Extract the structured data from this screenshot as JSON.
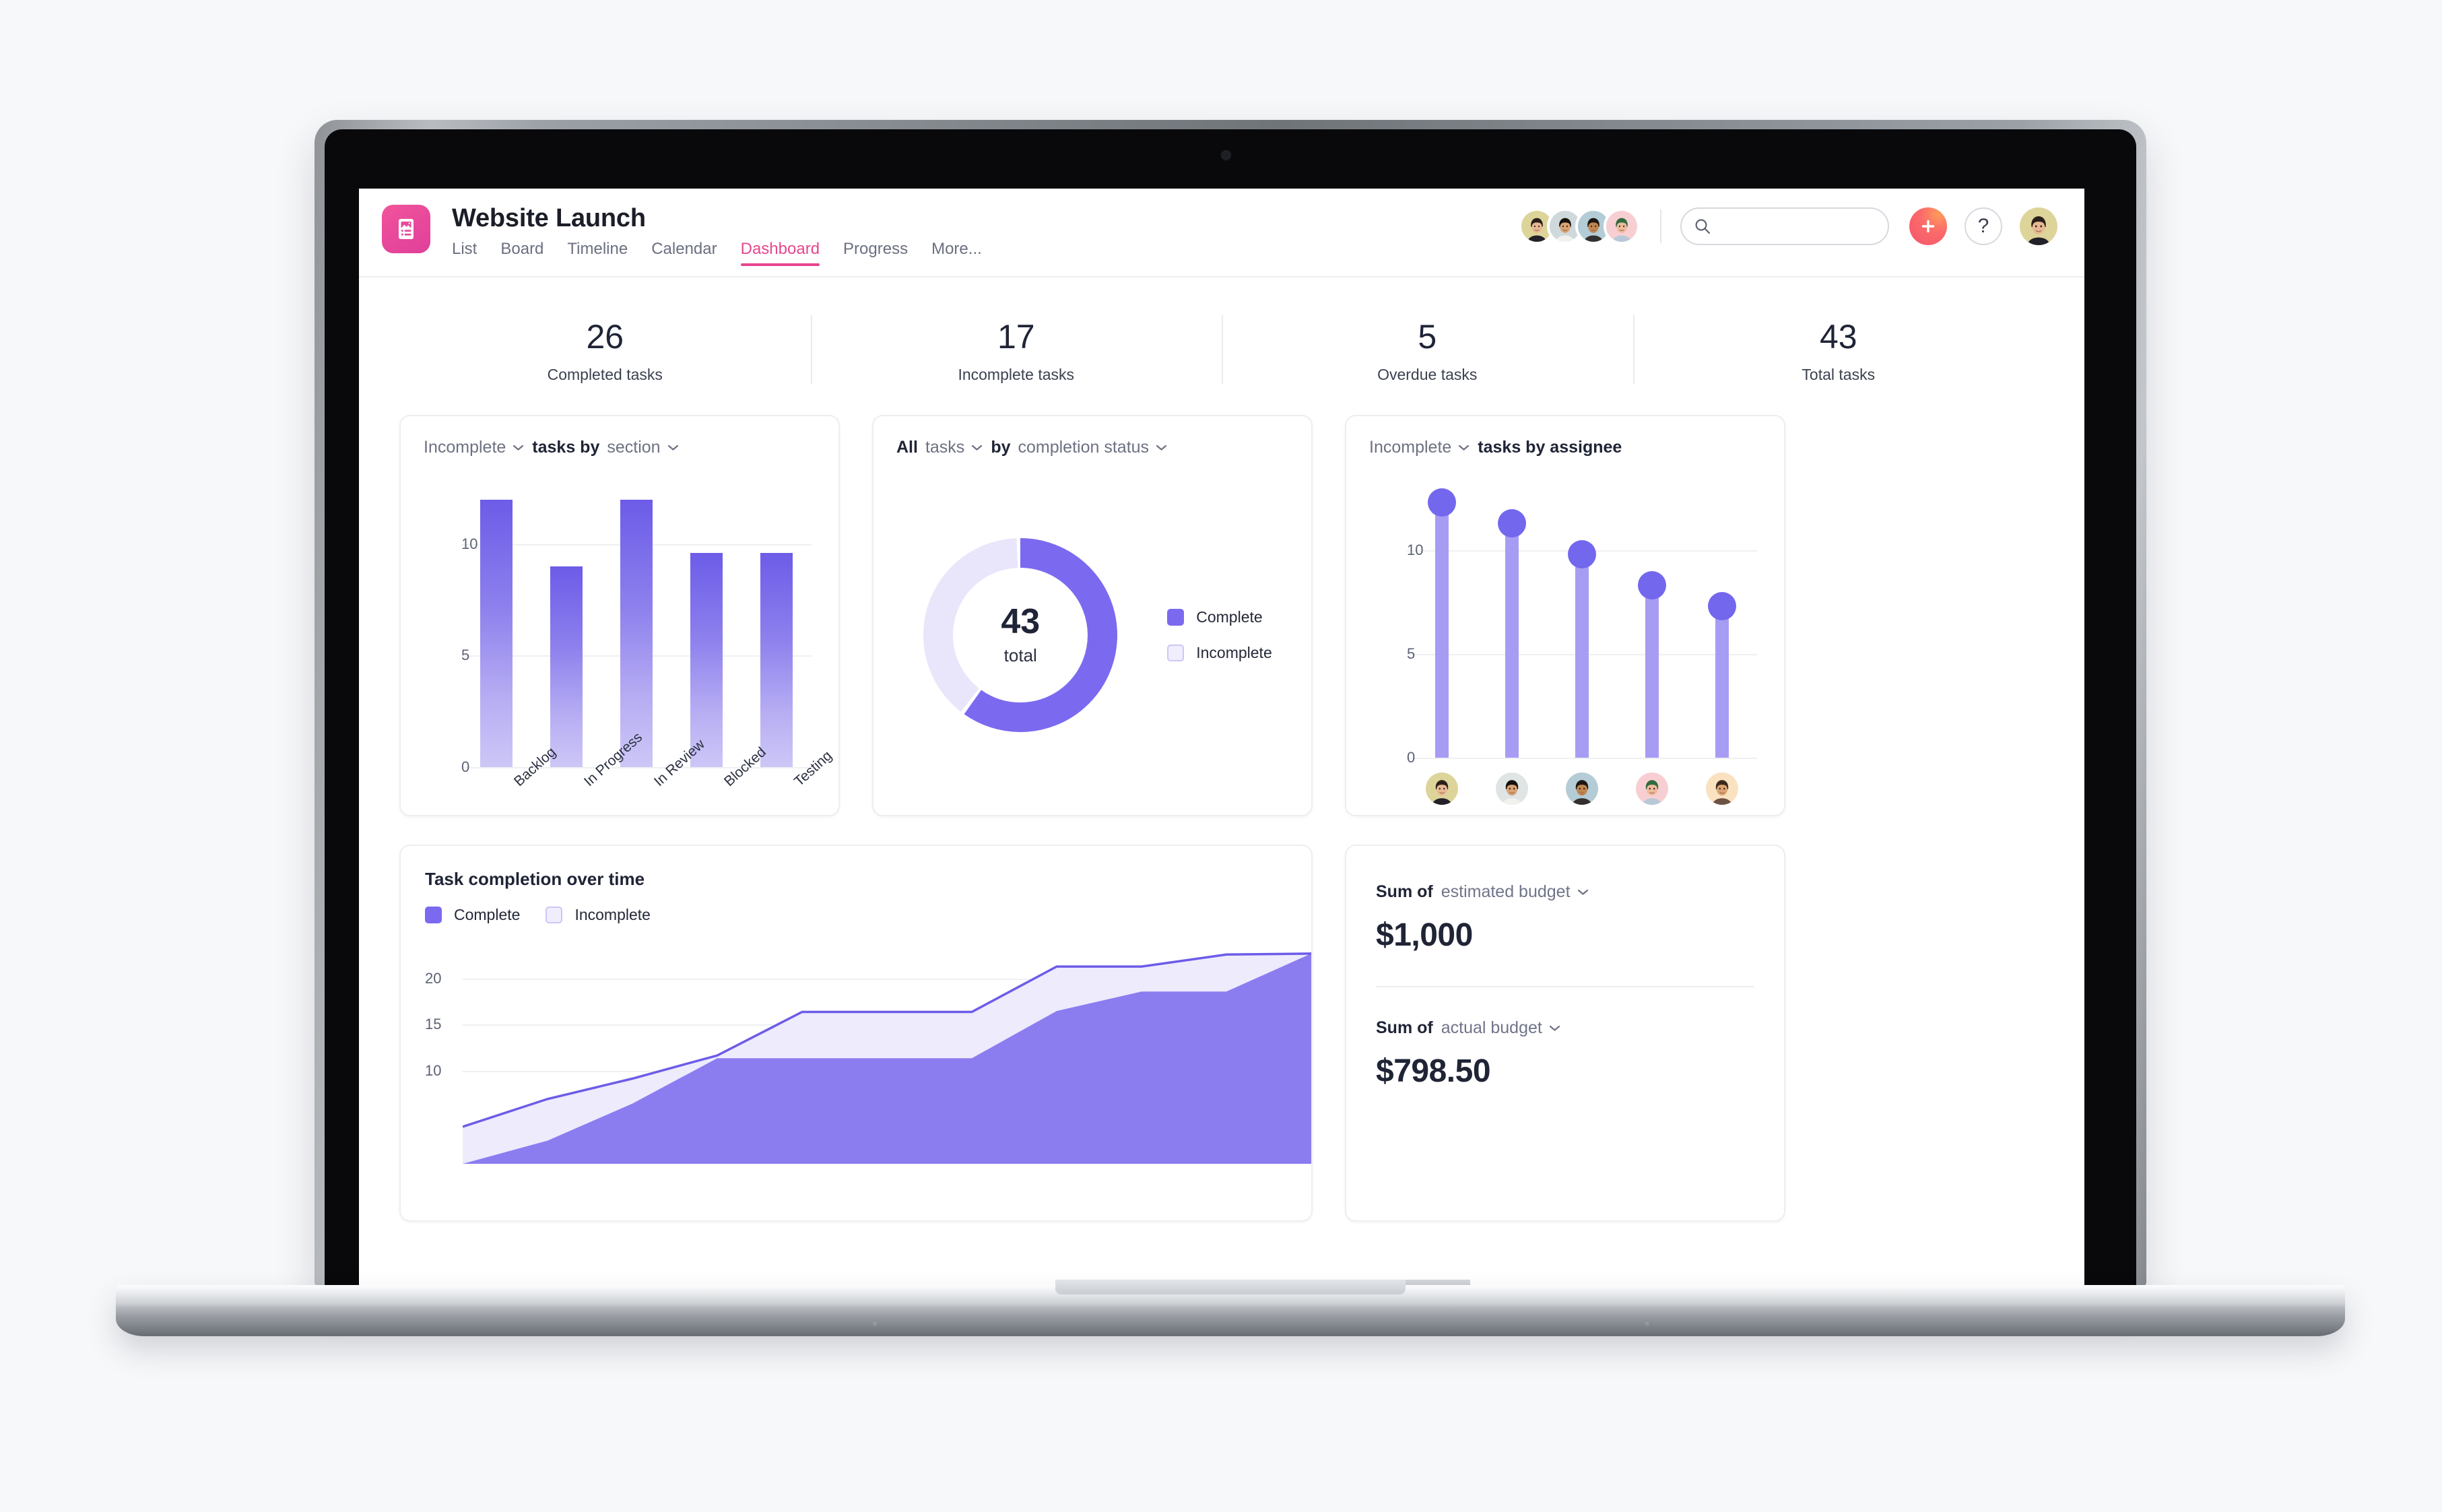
{
  "header": {
    "app_title": "Website Launch",
    "logo_icon": "project-page-icon",
    "tabs": [
      {
        "label": "List",
        "active": false
      },
      {
        "label": "Board",
        "active": false
      },
      {
        "label": "Timeline",
        "active": false
      },
      {
        "label": "Calendar",
        "active": false
      },
      {
        "label": "Dashboard",
        "active": true
      },
      {
        "label": "Progress",
        "active": false
      },
      {
        "label": "More...",
        "active": false
      }
    ],
    "member_avatars": [
      {
        "name": "member-1",
        "bg": "#ddd49a",
        "skin": "#e8b894",
        "hair": "#2a1f1a",
        "shirt": "#222028"
      },
      {
        "name": "member-2",
        "bg": "#cfd9dc",
        "skin": "#d8a273",
        "hair": "#15100e",
        "shirt": "#f2f1ee"
      },
      {
        "name": "member-3",
        "bg": "#b3ccd6",
        "skin": "#c08650",
        "hair": "#1c1713",
        "shirt": "#33302f"
      },
      {
        "name": "member-4",
        "bg": "#f7cfd3",
        "skin": "#eebb9c",
        "hair": "#2f6b3f",
        "shirt": "#b8c8d8"
      }
    ],
    "search": {
      "placeholder": "",
      "value": "",
      "icon": "search-icon"
    },
    "add_button": {
      "label": "+",
      "icon": "plus-icon",
      "color": "#f4566c"
    },
    "help_button": {
      "label": "?",
      "icon": "question-mark-icon"
    },
    "me_avatar": {
      "name": "current-user",
      "bg": "#ddd49a",
      "skin": "#e8b894",
      "hair": "#2a1f1a",
      "shirt": "#222028"
    }
  },
  "stats": [
    {
      "value": "26",
      "label": "Completed tasks"
    },
    {
      "value": "17",
      "label": "Incomplete tasks"
    },
    {
      "value": "5",
      "label": "Overdue tasks"
    },
    {
      "value": "43",
      "label": "Total tasks"
    }
  ],
  "cards": {
    "section_chart": {
      "filter": "Incomplete",
      "middle": "tasks by",
      "group_by": "section"
    },
    "status_chart": {
      "filter": "All",
      "mid1": "tasks",
      "mid2": "by",
      "group_by": "completion status",
      "center_value": "43",
      "center_label": "total",
      "legend": [
        {
          "label": "Complete",
          "color": "#7b6af0"
        },
        {
          "label": "Incomplete",
          "color": "#f0eefd"
        }
      ]
    },
    "assignee_chart": {
      "filter": "Incomplete",
      "title": "tasks by assignee",
      "avatars": [
        {
          "name": "assignee-1",
          "bg": "#ddd49a",
          "skin": "#e8b894",
          "hair": "#2a1f1a",
          "shirt": "#222028"
        },
        {
          "name": "assignee-2",
          "bg": "#dfe4e5",
          "skin": "#d8a273",
          "hair": "#15100e",
          "shirt": "#f2f1ee"
        },
        {
          "name": "assignee-3",
          "bg": "#b3ccd6",
          "skin": "#c08650",
          "hair": "#1c1713",
          "shirt": "#33302f"
        },
        {
          "name": "assignee-4",
          "bg": "#f7cfd3",
          "skin": "#eebb9c",
          "hair": "#2f6b3f",
          "shirt": "#b8c8d8"
        },
        {
          "name": "assignee-5",
          "bg": "#fae2c0",
          "skin": "#dba472",
          "hair": "#3a2a1c",
          "shirt": "#6d5244"
        }
      ]
    },
    "completion_over_time": {
      "title": "Task completion over time",
      "legend": [
        {
          "label": "Complete",
          "color": "#7b6af0"
        },
        {
          "label": "Incomplete",
          "color": "#f0eefd"
        }
      ]
    },
    "budget": {
      "estimated": {
        "prefix": "Sum of",
        "field": "estimated budget",
        "value": "$1,000"
      },
      "actual": {
        "prefix": "Sum of",
        "field": "actual budget",
        "value": "$798.50"
      }
    }
  },
  "chart_data": [
    {
      "type": "bar",
      "id": "incomplete-tasks-by-section",
      "title": "Incomplete tasks by section",
      "categories": [
        "Backlog",
        "In Progress",
        "In Review",
        "Blocked",
        "Testing"
      ],
      "values": [
        12,
        9,
        12,
        9.6,
        9.6
      ],
      "xlabel": "section",
      "ylabel": "",
      "ylim": [
        0,
        13
      ],
      "yticks": [
        0,
        5,
        10
      ],
      "grid": true,
      "legend": "none",
      "color": "#7b6af0"
    },
    {
      "type": "pie",
      "id": "all-tasks-by-completion-status",
      "title": "All tasks by completion status",
      "variant": "donut",
      "center_value": 43,
      "center_label": "total",
      "labels": [
        "Complete",
        "Incomplete"
      ],
      "values": [
        26,
        17
      ],
      "percent": [
        60.5,
        39.5
      ],
      "colors": [
        "#7b6af0",
        "#e9e6fb"
      ],
      "legend": "right"
    },
    {
      "type": "bar",
      "id": "incomplete-tasks-by-assignee",
      "variant": "lollipop",
      "title": "Incomplete tasks by assignee",
      "categories": [
        "assignee-1",
        "assignee-2",
        "assignee-3",
        "assignee-4",
        "assignee-5"
      ],
      "values": [
        12,
        11,
        9.5,
        8,
        7
      ],
      "ylim": [
        0,
        13
      ],
      "yticks": [
        0,
        5,
        10
      ],
      "grid": true,
      "stem_color": "#a79cf3",
      "knob_color": "#7367ee"
    },
    {
      "type": "area",
      "id": "task-completion-over-time",
      "title": "Task completion over time",
      "stacked": false,
      "x": [
        0,
        1,
        2,
        3,
        4,
        5,
        6,
        7,
        8,
        9,
        10
      ],
      "series": [
        {
          "name": "Incomplete",
          "values": [
            4,
            7,
            9.2,
            11.7,
            16.4,
            16.4,
            16.4,
            21.3,
            21.3,
            22.6,
            22.7
          ],
          "color": "#edebfc",
          "line": "#6c5ce8"
        },
        {
          "name": "Complete",
          "values": [
            0,
            2.5,
            6.5,
            11.4,
            11.4,
            11.4,
            11.4,
            16.5,
            18.6,
            18.6,
            22.7
          ],
          "color": "#8b7cf0",
          "line": "#8b7cf0"
        }
      ],
      "ylim": [
        0,
        24
      ],
      "yticks": [
        10,
        15,
        20
      ],
      "grid": true,
      "legend": "top-left"
    }
  ]
}
